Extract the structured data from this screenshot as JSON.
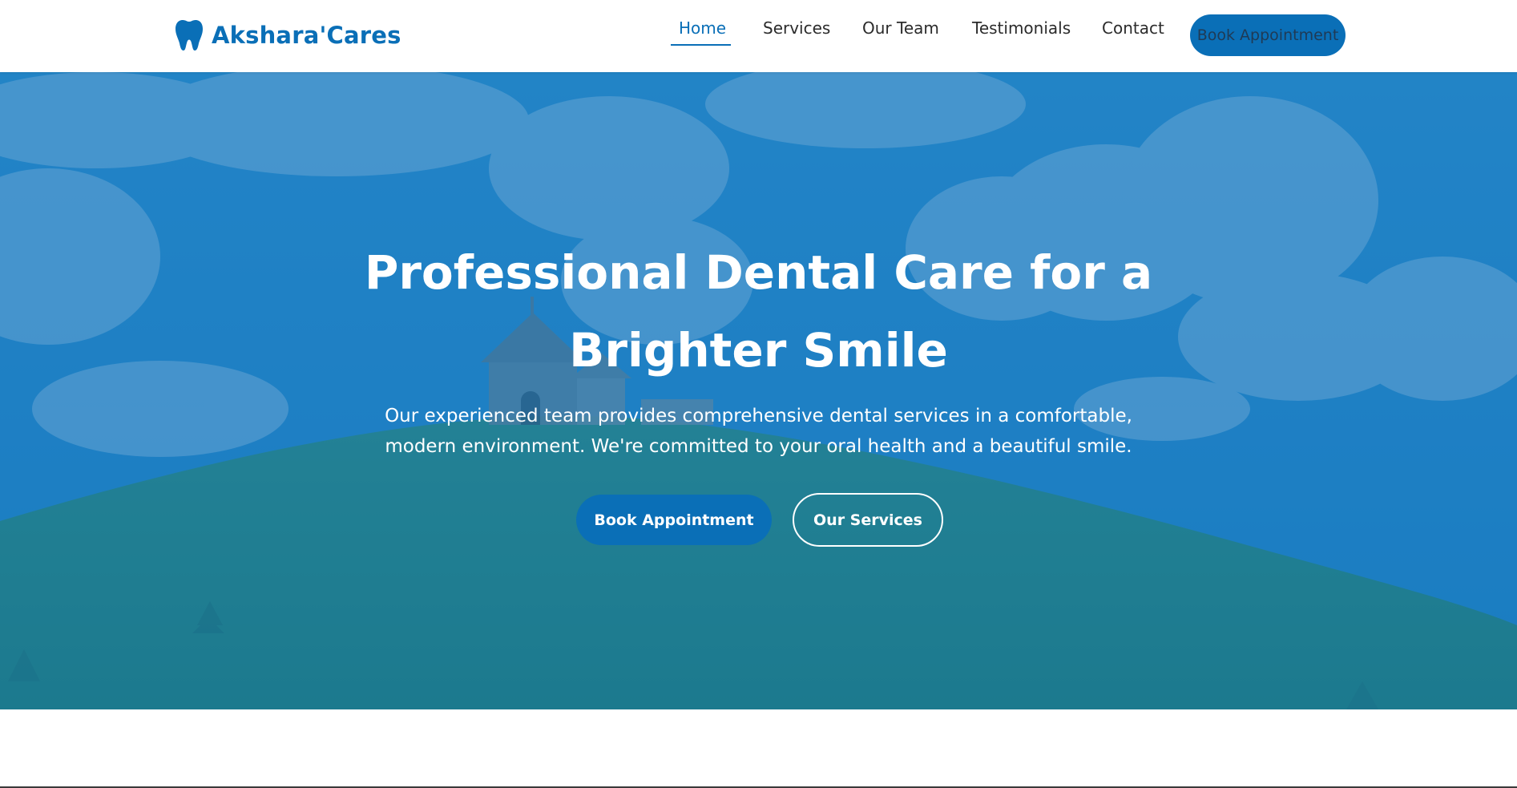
{
  "brand": {
    "name": "Akshara'Cares",
    "icon": "tooth-icon",
    "color": "#0a6fb7"
  },
  "nav": {
    "items": [
      {
        "label": "Home",
        "active": true
      },
      {
        "label": "Services",
        "active": false
      },
      {
        "label": "Our Team",
        "active": false
      },
      {
        "label": "Testimonials",
        "active": false
      },
      {
        "label": "Contact",
        "active": false
      }
    ],
    "cta_label": "Book Appointment"
  },
  "hero": {
    "title_line1": "Professional Dental Care for a",
    "title_line2": "Brighter Smile",
    "subtitle_line1": "Our experienced team provides comprehensive dental services in a comfortable,",
    "subtitle_line2": "modern environment. We're committed to your oral health and a beautiful smile.",
    "primary_button": "Book Appointment",
    "secondary_button": "Our Services",
    "overlay_color": "#0c6eb9"
  },
  "colors": {
    "accent": "#0a6fb7",
    "nav_text": "#2b2b2b",
    "header_bg": "#ffffff"
  }
}
